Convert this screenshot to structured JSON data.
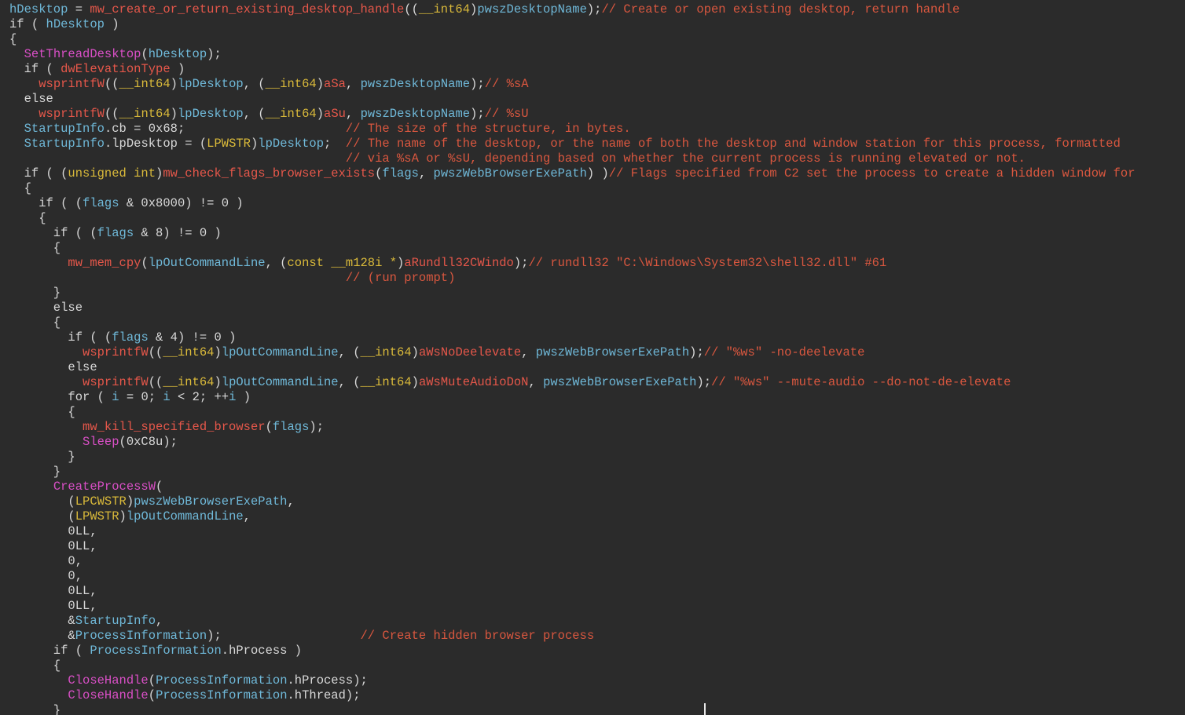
{
  "colors": {
    "background": "#2b2b2b",
    "plain": "#d8d8d8",
    "var": "#6fb8d8",
    "func": "#e5574a",
    "api": "#d94fc6",
    "type": "#d9b93a",
    "global": "#e5574a",
    "comment": "#d9573f"
  },
  "lines": [
    [
      [
        "var",
        "hDesktop"
      ],
      [
        "plain",
        " = "
      ],
      [
        "func",
        "mw_create_or_return_existing_desktop_handle"
      ],
      [
        "plain",
        "(("
      ],
      [
        "type",
        "__int64"
      ],
      [
        "plain",
        ")"
      ],
      [
        "var",
        "pwszDesktopName"
      ],
      [
        "plain",
        ");"
      ],
      [
        "comment",
        "// Create or open existing desktop, return handle"
      ]
    ],
    [
      [
        "plain",
        "if ( "
      ],
      [
        "var",
        "hDesktop"
      ],
      [
        "plain",
        " )"
      ]
    ],
    [
      [
        "plain",
        "{"
      ]
    ],
    [
      [
        "plain",
        "  "
      ],
      [
        "api",
        "SetThreadDesktop"
      ],
      [
        "plain",
        "("
      ],
      [
        "var",
        "hDesktop"
      ],
      [
        "plain",
        ");"
      ]
    ],
    [
      [
        "plain",
        "  if ( "
      ],
      [
        "global",
        "dwElevationType"
      ],
      [
        "plain",
        " )"
      ]
    ],
    [
      [
        "plain",
        "    "
      ],
      [
        "func",
        "wsprintfW"
      ],
      [
        "plain",
        "(("
      ],
      [
        "type",
        "__int64"
      ],
      [
        "plain",
        ")"
      ],
      [
        "var",
        "lpDesktop"
      ],
      [
        "plain",
        ", ("
      ],
      [
        "type",
        "__int64"
      ],
      [
        "plain",
        ")"
      ],
      [
        "global",
        "aSa"
      ],
      [
        "plain",
        ", "
      ],
      [
        "var",
        "pwszDesktopName"
      ],
      [
        "plain",
        ");"
      ],
      [
        "comment",
        "// %sA"
      ]
    ],
    [
      [
        "plain",
        "  else"
      ]
    ],
    [
      [
        "plain",
        "    "
      ],
      [
        "func",
        "wsprintfW"
      ],
      [
        "plain",
        "(("
      ],
      [
        "type",
        "__int64"
      ],
      [
        "plain",
        ")"
      ],
      [
        "var",
        "lpDesktop"
      ],
      [
        "plain",
        ", ("
      ],
      [
        "type",
        "__int64"
      ],
      [
        "plain",
        ")"
      ],
      [
        "global",
        "aSu"
      ],
      [
        "plain",
        ", "
      ],
      [
        "var",
        "pwszDesktopName"
      ],
      [
        "plain",
        ");"
      ],
      [
        "comment",
        "// %sU"
      ]
    ],
    [
      [
        "plain",
        "  "
      ],
      [
        "var",
        "StartupInfo"
      ],
      [
        "plain",
        ".cb = 0x68;                      "
      ],
      [
        "comment",
        "// The size of the structure, in bytes."
      ]
    ],
    [
      [
        "plain",
        "  "
      ],
      [
        "var",
        "StartupInfo"
      ],
      [
        "plain",
        ".lpDesktop = ("
      ],
      [
        "type",
        "LPWSTR"
      ],
      [
        "plain",
        ")"
      ],
      [
        "var",
        "lpDesktop"
      ],
      [
        "plain",
        ";  "
      ],
      [
        "comment",
        "// The name of the desktop, or the name of both the desktop and window station for this process, formatted"
      ]
    ],
    [
      [
        "plain",
        "                                              "
      ],
      [
        "comment",
        "// via %sA or %sU, depending based on whether the current process is running elevated or not."
      ]
    ],
    [
      [
        "plain",
        "  if ( ("
      ],
      [
        "type",
        "unsigned int"
      ],
      [
        "plain",
        ")"
      ],
      [
        "func",
        "mw_check_flags_browser_exists"
      ],
      [
        "plain",
        "("
      ],
      [
        "var",
        "flags"
      ],
      [
        "plain",
        ", "
      ],
      [
        "var",
        "pwszWebBrowserExePath"
      ],
      [
        "plain",
        ") )"
      ],
      [
        "comment",
        "// Flags specified from C2 set the process to create a hidden window for"
      ]
    ],
    [
      [
        "plain",
        "  {"
      ]
    ],
    [
      [
        "plain",
        "    if ( ("
      ],
      [
        "var",
        "flags"
      ],
      [
        "plain",
        " & 0x8000) != 0 )"
      ]
    ],
    [
      [
        "plain",
        "    {"
      ]
    ],
    [
      [
        "plain",
        "      if ( ("
      ],
      [
        "var",
        "flags"
      ],
      [
        "plain",
        " & 8) != 0 )"
      ]
    ],
    [
      [
        "plain",
        "      {"
      ]
    ],
    [
      [
        "plain",
        "        "
      ],
      [
        "func",
        "mw_mem_cpy"
      ],
      [
        "plain",
        "("
      ],
      [
        "var",
        "lpOutCommandLine"
      ],
      [
        "plain",
        ", ("
      ],
      [
        "type",
        "const __m128i *"
      ],
      [
        "plain",
        ")"
      ],
      [
        "global",
        "aRundll32CWindo"
      ],
      [
        "plain",
        ");"
      ],
      [
        "comment",
        "// rundll32 \"C:\\Windows\\System32\\shell32.dll\" #61"
      ]
    ],
    [
      [
        "plain",
        "                                              "
      ],
      [
        "comment",
        "// (run prompt)"
      ]
    ],
    [
      [
        "plain",
        "      }"
      ]
    ],
    [
      [
        "plain",
        "      else"
      ]
    ],
    [
      [
        "plain",
        "      {"
      ]
    ],
    [
      [
        "plain",
        "        if ( ("
      ],
      [
        "var",
        "flags"
      ],
      [
        "plain",
        " & 4) != 0 )"
      ]
    ],
    [
      [
        "plain",
        "          "
      ],
      [
        "func",
        "wsprintfW"
      ],
      [
        "plain",
        "(("
      ],
      [
        "type",
        "__int64"
      ],
      [
        "plain",
        ")"
      ],
      [
        "var",
        "lpOutCommandLine"
      ],
      [
        "plain",
        ", ("
      ],
      [
        "type",
        "__int64"
      ],
      [
        "plain",
        ")"
      ],
      [
        "global",
        "aWsNoDeelevate"
      ],
      [
        "plain",
        ", "
      ],
      [
        "var",
        "pwszWebBrowserExePath"
      ],
      [
        "plain",
        ");"
      ],
      [
        "comment",
        "// \"%ws\" -no-deelevate"
      ]
    ],
    [
      [
        "plain",
        "        else"
      ]
    ],
    [
      [
        "plain",
        "          "
      ],
      [
        "func",
        "wsprintfW"
      ],
      [
        "plain",
        "(("
      ],
      [
        "type",
        "__int64"
      ],
      [
        "plain",
        ")"
      ],
      [
        "var",
        "lpOutCommandLine"
      ],
      [
        "plain",
        ", ("
      ],
      [
        "type",
        "__int64"
      ],
      [
        "plain",
        ")"
      ],
      [
        "global",
        "aWsMuteAudioDoN"
      ],
      [
        "plain",
        ", "
      ],
      [
        "var",
        "pwszWebBrowserExePath"
      ],
      [
        "plain",
        ");"
      ],
      [
        "comment",
        "// \"%ws\" --mute-audio --do-not-de-elevate"
      ]
    ],
    [
      [
        "plain",
        "        for ( "
      ],
      [
        "var",
        "i"
      ],
      [
        "plain",
        " = 0; "
      ],
      [
        "var",
        "i"
      ],
      [
        "plain",
        " < 2; ++"
      ],
      [
        "var",
        "i"
      ],
      [
        "plain",
        " )"
      ]
    ],
    [
      [
        "plain",
        "        {"
      ]
    ],
    [
      [
        "plain",
        "          "
      ],
      [
        "func",
        "mw_kill_specified_browser"
      ],
      [
        "plain",
        "("
      ],
      [
        "var",
        "flags"
      ],
      [
        "plain",
        ");"
      ]
    ],
    [
      [
        "plain",
        "          "
      ],
      [
        "api",
        "Sleep"
      ],
      [
        "plain",
        "(0xC8u);"
      ]
    ],
    [
      [
        "plain",
        "        }"
      ]
    ],
    [
      [
        "plain",
        "      }"
      ]
    ],
    [
      [
        "plain",
        "      "
      ],
      [
        "api",
        "CreateProcessW"
      ],
      [
        "plain",
        "("
      ]
    ],
    [
      [
        "plain",
        "        ("
      ],
      [
        "type",
        "LPCWSTR"
      ],
      [
        "plain",
        ")"
      ],
      [
        "var",
        "pwszWebBrowserExePath"
      ],
      [
        "plain",
        ","
      ]
    ],
    [
      [
        "plain",
        "        ("
      ],
      [
        "type",
        "LPWSTR"
      ],
      [
        "plain",
        ")"
      ],
      [
        "var",
        "lpOutCommandLine"
      ],
      [
        "plain",
        ","
      ]
    ],
    [
      [
        "plain",
        "        0LL,"
      ]
    ],
    [
      [
        "plain",
        "        0LL,"
      ]
    ],
    [
      [
        "plain",
        "        0,"
      ]
    ],
    [
      [
        "plain",
        "        0,"
      ]
    ],
    [
      [
        "plain",
        "        0LL,"
      ]
    ],
    [
      [
        "plain",
        "        0LL,"
      ]
    ],
    [
      [
        "plain",
        "        &"
      ],
      [
        "var",
        "StartupInfo"
      ],
      [
        "plain",
        ","
      ]
    ],
    [
      [
        "plain",
        "        &"
      ],
      [
        "var",
        "ProcessInformation"
      ],
      [
        "plain",
        ");                   "
      ],
      [
        "comment",
        "// Create hidden browser process"
      ]
    ],
    [
      [
        "plain",
        "      if ( "
      ],
      [
        "var",
        "ProcessInformation"
      ],
      [
        "plain",
        ".hProcess )"
      ]
    ],
    [
      [
        "plain",
        "      {"
      ]
    ],
    [
      [
        "plain",
        "        "
      ],
      [
        "api",
        "CloseHandle"
      ],
      [
        "plain",
        "("
      ],
      [
        "var",
        "ProcessInformation"
      ],
      [
        "plain",
        ".hProcess);"
      ]
    ],
    [
      [
        "plain",
        "        "
      ],
      [
        "api",
        "CloseHandle"
      ],
      [
        "plain",
        "("
      ],
      [
        "var",
        "ProcessInformation"
      ],
      [
        "plain",
        ".hThread);"
      ]
    ],
    [
      [
        "plain",
        "      }"
      ]
    ]
  ]
}
